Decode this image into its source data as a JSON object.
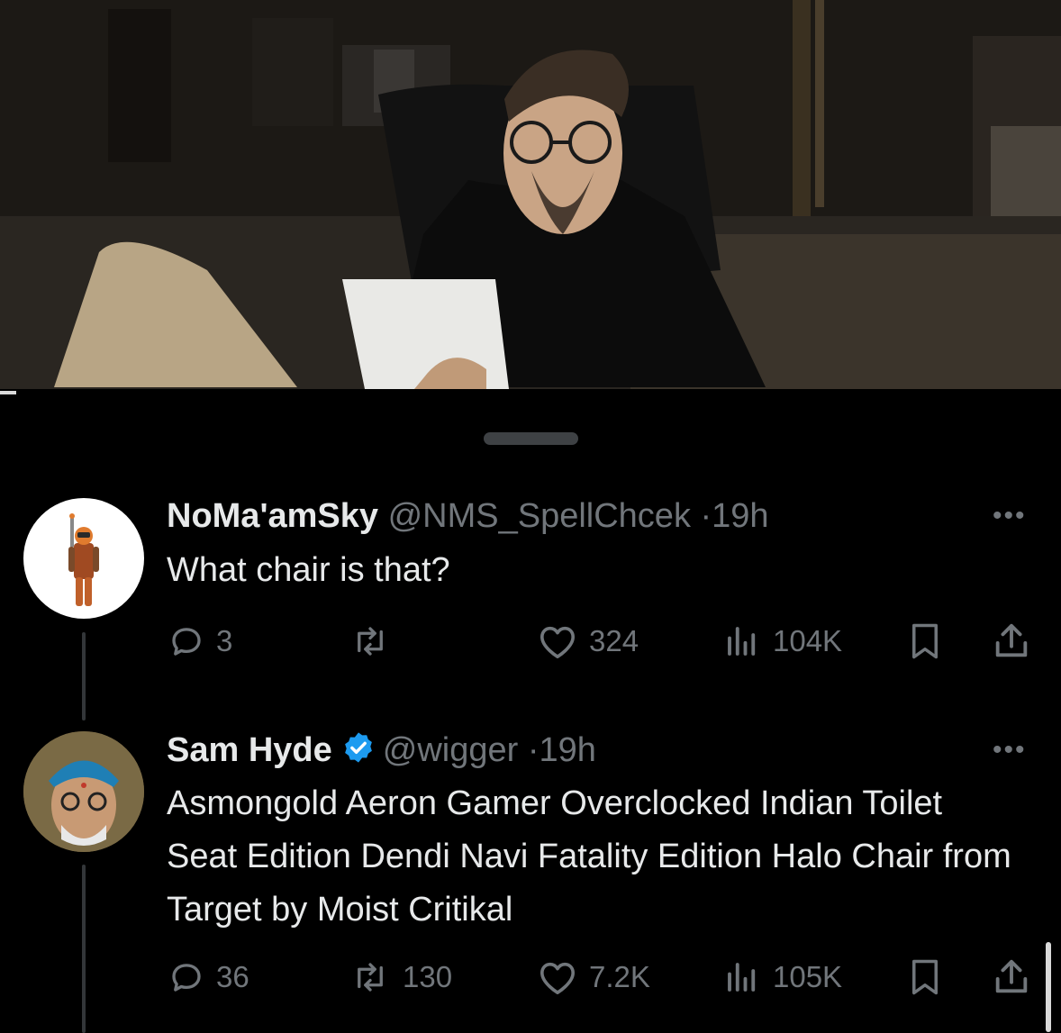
{
  "media": {
    "description_icon": "video-frame"
  },
  "tweets": [
    {
      "author": "NoMa'amSky",
      "handle": "@NMS_SpellChcek",
      "separator": "·",
      "time": "19h",
      "verified": false,
      "text": "What chair is that?",
      "replies": "3",
      "reposts": "",
      "likes": "324",
      "views": "104K",
      "more_label": "•••"
    },
    {
      "author": "Sam Hyde",
      "handle": "@wigger",
      "separator": "·",
      "time": "19h",
      "verified": true,
      "text": "Asmongold Aeron Gamer Overclocked Indian Toilet Seat Edition Dendi Navi Fatality Edition Halo Chair from Target by Moist Critikal",
      "replies": "36",
      "reposts": "130",
      "likes": "7.2K",
      "views": "105K",
      "more_label": "•••"
    }
  ],
  "colors": {
    "background": "#000000",
    "text": "#e7e9ea",
    "secondary": "#71767b",
    "verified": "#1d9bf0",
    "thread_line": "#333639"
  }
}
